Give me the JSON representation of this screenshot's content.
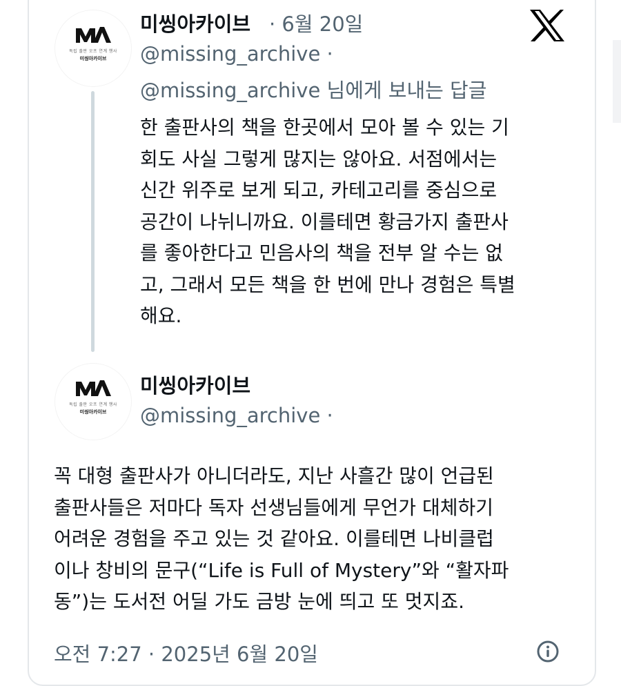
{
  "parent_post": {
    "display_name": "미씽아카이브",
    "date": "· 6월 20일",
    "handle": "@missing_archive ·",
    "reply_to": "@missing_archive 님에게 보내는 답글",
    "avatar": {
      "logo_text": "MA",
      "small_line": "독립 출판 오프 연계 행사",
      "name_line": "미씽아카이브"
    },
    "lines": [
      "한 출판사의 책을 한곳에서 모아 볼 수 있는 기",
      "회도 사실 그렇게 많지는 않아요. 서점에서는",
      "신간 위주로 보게 되고, 카테고리를 중심으로",
      "공간이 나뉘니까요. 이를테면 황금가지 출판사",
      "를 좋아한다고 민음사의 책을 전부 알 수는 없",
      "고, 그래서 모든 책을 한 번에 만나 경험은 특별",
      "해요."
    ]
  },
  "main_post": {
    "display_name": "미씽아카이브",
    "handle": "@missing_archive ·",
    "avatar": {
      "logo_text": "MA",
      "small_line": "독립 출판 오프 연계 행사",
      "name_line": "미씽아카이브"
    },
    "lines": [
      "꼭 대형 출판사가 아니더라도, 지난 사흘간 많이 언급된",
      "출판사들은 저마다 독자 선생님들에게 무언가 대체하기",
      "어려운 경험을 주고 있는 것 같아요. 이를테면 나비클럽",
      "이나 창비의 문구(“Life is Full of Mystery”와 “활자파",
      "동”)는 도서전 어딜 가도 금방 눈에 띄고 또 멋지죠."
    ],
    "timestamp": "오전 7:27 · 2025년 6월 20일"
  },
  "icons": {
    "brand": "x-logo-icon",
    "info": "info-icon"
  },
  "colors": {
    "text_primary": "#0f1419",
    "text_secondary": "#536471",
    "thread_line": "#cfd9de",
    "border": "#e4e7ea"
  }
}
